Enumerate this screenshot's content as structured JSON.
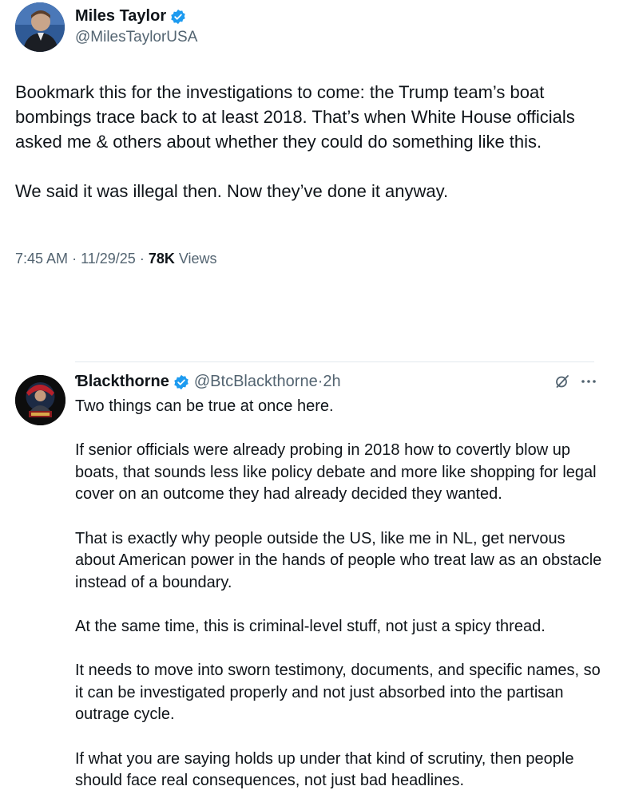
{
  "main_post": {
    "author_name": "Miles Taylor",
    "handle": "@MilesTaylorUSA",
    "paragraphs": [
      "Bookmark this for the investigations to come: the Trump team’s boat bombings trace back to at least 2018. That’s when White House officials asked me & others about whether they could do something like this.",
      "We said it was illegal then. Now they’ve done it anyway."
    ],
    "time": "7:45 AM",
    "date": "11/29/25",
    "views_count": "78K",
    "views_label": "Views"
  },
  "reply": {
    "author_name": "Ɓlackthorne",
    "handle": "@BtcBlackthorne",
    "time_ago": "2h",
    "paragraphs": [
      "Two things can be true at once here.",
      "If senior officials were already probing in 2018 how to covertly blow up boats, that sounds less like policy debate and more like shopping for legal cover on an outcome they had already decided they wanted.",
      "That is exactly why people outside the US, like me in NL, get nervous about American power in the hands of people who treat law as an obstacle instead of a boundary.",
      "At the same time, this is criminal-level stuff, not just a spicy thread.",
      "It needs to move into sworn testimony, documents, and specific names, so it can be investigated properly and not just absorbed into the partisan outrage cycle.",
      "If what you are saying holds up under that kind of scrutiny, then people should face real consequences, not just bad headlines."
    ]
  },
  "colors": {
    "verified_blue": "#1d9bf0",
    "secondary_text": "#536471",
    "primary_text": "#0f1419"
  },
  "icons": {
    "verified": "verified-badge-icon",
    "grok": "grok-icon",
    "more": "more-icon"
  }
}
